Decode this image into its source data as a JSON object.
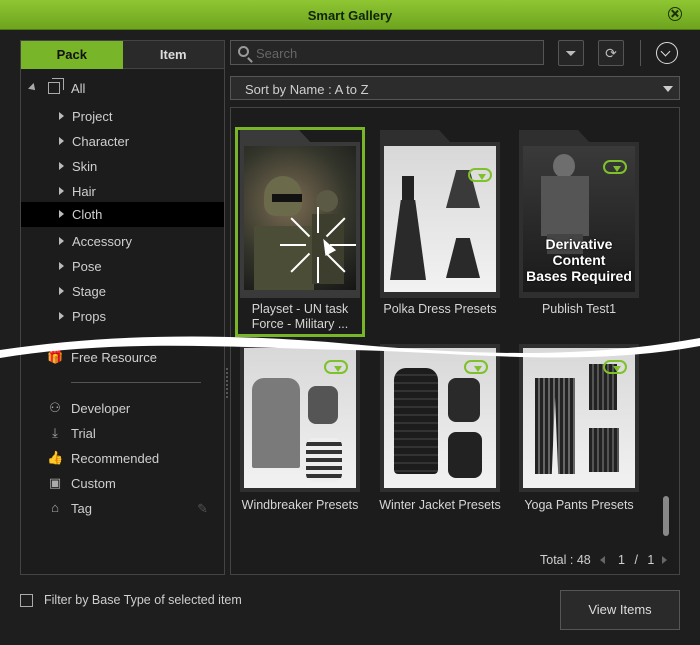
{
  "window": {
    "title": "Smart Gallery"
  },
  "left_panel": {
    "tabs": [
      {
        "label": "Pack",
        "active": true
      },
      {
        "label": "Item",
        "active": false
      }
    ],
    "tree": {
      "root": "All",
      "items": [
        {
          "label": "Project"
        },
        {
          "label": "Character"
        },
        {
          "label": "Skin"
        },
        {
          "label": "Hair"
        },
        {
          "label": "Cloth",
          "selected": true
        },
        {
          "label": "Accessory"
        },
        {
          "label": "Pose"
        },
        {
          "label": "Stage"
        },
        {
          "label": "Props"
        }
      ]
    },
    "free_resource": "Free Resource",
    "links": [
      {
        "label": "Developer",
        "icon": "developer-icon"
      },
      {
        "label": "Trial",
        "icon": "trial-icon"
      },
      {
        "label": "Recommended",
        "icon": "thumbs-up-icon"
      },
      {
        "label": "Custom",
        "icon": "custom-icon"
      },
      {
        "label": "Tag",
        "icon": "tag-icon"
      }
    ]
  },
  "toolbar": {
    "search_placeholder": "Search",
    "sort_label": "Sort by Name : A to Z"
  },
  "gallery": {
    "items": [
      {
        "caption_line1": "Playset - UN task",
        "caption_line2": "Force - Military ...",
        "selected": true
      },
      {
        "caption_line1": "Polka Dress Presets"
      },
      {
        "caption_line1": "Publish Test1",
        "overlay_line1": "Derivative Content",
        "overlay_line2": "Bases Required"
      },
      {
        "caption_line1": "Windbreaker Presets"
      },
      {
        "caption_line1": "Winter Jacket Presets"
      },
      {
        "caption_line1": "Yoga Pants Presets"
      }
    ],
    "total_label": "Total : 48",
    "page_current": "1",
    "page_separator": "/",
    "page_total": "1"
  },
  "footer": {
    "filter_label": "Filter by Base Type of selected item",
    "view_button": "View Items"
  },
  "colors": {
    "accent": "#79b529",
    "background": "#1e1e1e"
  }
}
